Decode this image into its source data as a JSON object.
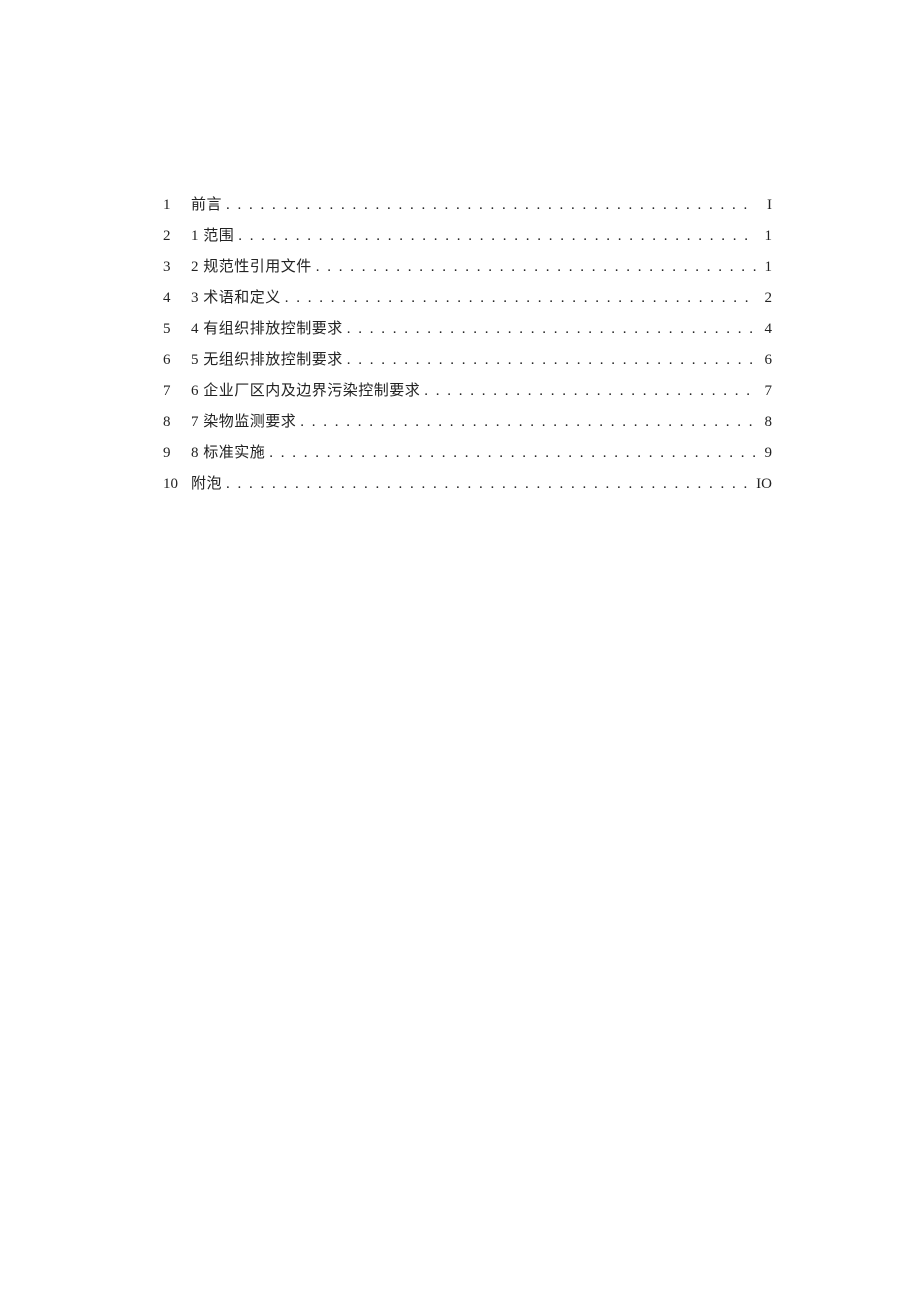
{
  "toc": {
    "dots": ". . . . . . . . . . . . . . . . . . . . . . . . . . . . . . . . . . . . . . . . . . . . . . . . . . . . . . . . . . . . . . . . . . . . . . . . . . . . . . . . . . . . . . . . . . . . . . . . . . . . . . . . . . . . . . . .",
    "items": [
      {
        "num": "1",
        "label": "前言",
        "page": "I"
      },
      {
        "num": "2",
        "label": "1 范围",
        "page": "1"
      },
      {
        "num": "3",
        "label": "2 规范性引用文件",
        "page": "1"
      },
      {
        "num": "4",
        "label": "3 术语和定义",
        "page": "2"
      },
      {
        "num": "5",
        "label": "4 有组织排放控制要求",
        "page": "4"
      },
      {
        "num": "6",
        "label": "5 无组织排放控制要求",
        "page": "6"
      },
      {
        "num": "7",
        "label": "6 企业厂区内及边界污染控制要求",
        "page": "7"
      },
      {
        "num": "8",
        "label": "7 染物监测要求",
        "page": "8"
      },
      {
        "num": "9",
        "label": "8 标准实施",
        "page": "9"
      },
      {
        "num": "10",
        "label": "附泡",
        "page": "IO"
      }
    ]
  }
}
